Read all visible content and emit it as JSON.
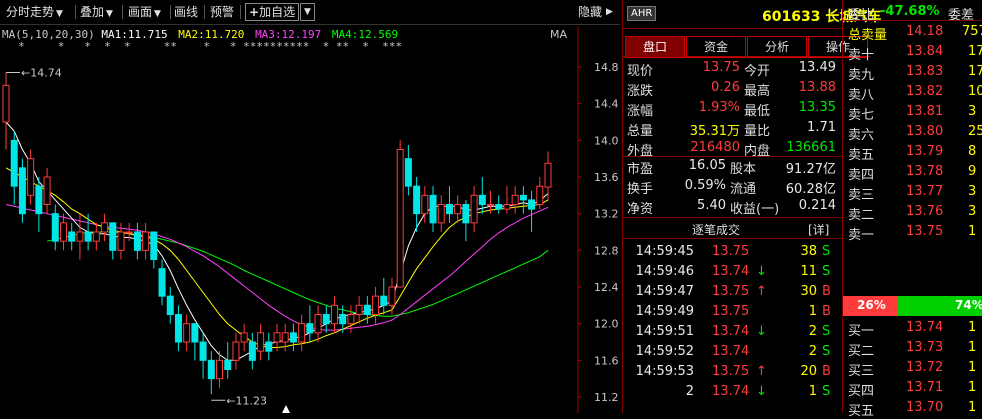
{
  "toolbar": {
    "items": [
      "分时走势",
      "叠加",
      "画面",
      "画线",
      "预警",
      "加自选"
    ],
    "hide_label": "隐藏"
  },
  "ma_legend": {
    "label": "MA(5,10,20,30)",
    "ma1": "MA1:11.715",
    "ma2": "MA2:11.720",
    "ma3": "MA3:12.197",
    "ma4": "MA4:12.569",
    "right_tag": "MA",
    "colors": {
      "ma1": "#ffffff",
      "ma2": "#ffff00",
      "ma3": "#ff40ff",
      "ma4": "#00ff00"
    }
  },
  "chart_data": {
    "type": "candlestick",
    "ylim": [
      11.2,
      14.8
    ],
    "y_ticks": [
      "14.8",
      "14.4",
      "14.0",
      "13.6",
      "13.2",
      "12.8",
      "12.4",
      "12.0",
      "11.6",
      "11.2"
    ],
    "high_label": "14.74",
    "low_label": "11.23",
    "star_markers": "*     *   *  *  *     **    *   * **********  * **  *  ***",
    "candles": [
      [
        14.2,
        14.6,
        14.74,
        13.9
      ],
      [
        14.0,
        13.5,
        14.1,
        13.3
      ],
      [
        13.7,
        13.2,
        13.8,
        13.1
      ],
      [
        13.4,
        13.8,
        13.9,
        13.3
      ],
      [
        13.5,
        13.2,
        13.6,
        13.0
      ],
      [
        13.3,
        13.6,
        13.7,
        13.2
      ],
      [
        13.2,
        12.9,
        13.3,
        12.8
      ],
      [
        12.9,
        13.1,
        13.2,
        12.8
      ],
      [
        13.0,
        12.9,
        13.1,
        12.8
      ],
      [
        12.9,
        13.0,
        13.2,
        12.7
      ],
      [
        13.0,
        12.9,
        13.2,
        12.8
      ],
      [
        12.9,
        13.0,
        13.1,
        12.8
      ],
      [
        13.0,
        13.1,
        13.2,
        12.9
      ],
      [
        13.1,
        12.8,
        13.1,
        12.7
      ],
      [
        12.8,
        13.0,
        13.1,
        12.7
      ],
      [
        13.0,
        13.0,
        13.1,
        12.9
      ],
      [
        13.0,
        12.8,
        13.1,
        12.7
      ],
      [
        12.8,
        13.0,
        13.1,
        12.7
      ],
      [
        13.0,
        12.7,
        13.0,
        12.6
      ],
      [
        12.6,
        12.3,
        12.7,
        12.2
      ],
      [
        12.3,
        12.1,
        12.4,
        12.0
      ],
      [
        12.1,
        11.8,
        12.2,
        11.7
      ],
      [
        11.8,
        12.0,
        12.1,
        11.7
      ],
      [
        12.0,
        11.8,
        12.0,
        11.6
      ],
      [
        11.8,
        11.6,
        11.9,
        11.4
      ],
      [
        11.6,
        11.4,
        11.7,
        11.23
      ],
      [
        11.4,
        11.6,
        11.7,
        11.3
      ],
      [
        11.6,
        11.5,
        11.8,
        11.4
      ],
      [
        11.6,
        11.8,
        11.9,
        11.5
      ],
      [
        11.8,
        11.9,
        12.0,
        11.7
      ],
      [
        11.8,
        11.6,
        11.9,
        11.5
      ],
      [
        11.7,
        11.9,
        12.0,
        11.6
      ],
      [
        11.8,
        11.7,
        11.9,
        11.6
      ],
      [
        11.8,
        11.9,
        12.0,
        11.7
      ],
      [
        11.8,
        11.9,
        12.0,
        11.7
      ],
      [
        11.9,
        11.8,
        12.0,
        11.7
      ],
      [
        11.8,
        12.0,
        12.1,
        11.7
      ],
      [
        12.0,
        11.9,
        12.2,
        11.8
      ],
      [
        11.9,
        12.1,
        12.2,
        11.8
      ],
      [
        12.1,
        12.0,
        12.2,
        11.9
      ],
      [
        12.0,
        12.2,
        12.3,
        11.9
      ],
      [
        12.1,
        12.0,
        12.2,
        11.9
      ],
      [
        12.0,
        12.1,
        12.2,
        11.9
      ],
      [
        12.1,
        12.2,
        12.3,
        12.0
      ],
      [
        12.2,
        12.1,
        12.3,
        12.0
      ],
      [
        12.1,
        12.3,
        12.4,
        12.0
      ],
      [
        12.3,
        12.2,
        12.5,
        12.1
      ],
      [
        12.2,
        12.4,
        12.5,
        12.1
      ],
      [
        12.4,
        13.9,
        14.0,
        12.4
      ],
      [
        13.8,
        13.5,
        13.95,
        13.4
      ],
      [
        13.5,
        13.2,
        13.6,
        13.0
      ],
      [
        13.2,
        13.4,
        13.5,
        13.1
      ],
      [
        13.4,
        13.1,
        13.5,
        13.0
      ],
      [
        13.1,
        13.3,
        13.4,
        13.0
      ],
      [
        13.3,
        13.2,
        13.5,
        13.1
      ],
      [
        13.2,
        13.3,
        13.4,
        13.1
      ],
      [
        13.3,
        13.1,
        13.35,
        12.9
      ],
      [
        13.1,
        13.4,
        13.5,
        13.0
      ],
      [
        13.4,
        13.3,
        13.6,
        13.2
      ],
      [
        13.3,
        13.3,
        13.45,
        13.2
      ],
      [
        13.3,
        13.25,
        13.4,
        13.2
      ],
      [
        13.25,
        13.3,
        13.5,
        13.2
      ],
      [
        13.3,
        13.4,
        13.5,
        13.2
      ],
      [
        13.4,
        13.35,
        13.5,
        13.2
      ],
      [
        13.35,
        13.25,
        13.45,
        13.0
      ],
      [
        13.3,
        13.5,
        13.6,
        13.25
      ],
      [
        13.49,
        13.75,
        13.88,
        13.35
      ]
    ],
    "ma1": [
      14.2,
      14.1,
      13.9,
      13.75,
      13.55,
      13.45,
      13.35,
      13.25,
      13.15,
      13.05,
      13.0,
      12.98,
      12.98,
      12.96,
      12.94,
      12.94,
      12.92,
      12.9,
      12.86,
      12.74,
      12.58,
      12.38,
      12.2,
      12.04,
      11.9,
      11.76,
      11.66,
      11.6,
      11.6,
      11.65,
      11.7,
      11.76,
      11.78,
      11.8,
      11.82,
      11.84,
      11.86,
      11.9,
      11.95,
      12.0,
      12.05,
      12.08,
      12.1,
      12.12,
      12.14,
      12.16,
      12.2,
      12.25,
      12.55,
      12.85,
      13.05,
      13.2,
      13.28,
      13.28,
      13.28,
      13.28,
      13.24,
      13.24,
      13.26,
      13.28,
      13.28,
      13.28,
      13.3,
      13.32,
      13.3,
      13.34,
      13.42
    ],
    "ma2": [
      13.7,
      13.65,
      13.6,
      13.55,
      13.5,
      13.45,
      13.4,
      13.33,
      13.25,
      13.2,
      13.14,
      13.08,
      13.05,
      13.02,
      13.0,
      12.98,
      12.96,
      12.95,
      12.92,
      12.87,
      12.8,
      12.7,
      12.58,
      12.46,
      12.34,
      12.22,
      12.1,
      12.0,
      11.93,
      11.86,
      11.8,
      11.76,
      11.74,
      11.74,
      11.75,
      11.77,
      11.78,
      11.8,
      11.83,
      11.87,
      11.9,
      11.94,
      11.98,
      12.02,
      12.06,
      12.09,
      12.12,
      12.15,
      12.3,
      12.45,
      12.6,
      12.72,
      12.84,
      12.95,
      13.05,
      13.12,
      13.16,
      13.2,
      13.22,
      13.24,
      13.25,
      13.26,
      13.27,
      13.28,
      13.29,
      13.3,
      13.35
    ],
    "ma3": [
      13.3,
      13.28,
      13.26,
      13.24,
      13.22,
      13.2,
      13.18,
      13.16,
      13.14,
      13.12,
      13.1,
      13.08,
      13.06,
      13.05,
      13.04,
      13.03,
      13.02,
      13.0,
      12.98,
      12.95,
      12.92,
      12.88,
      12.84,
      12.79,
      12.74,
      12.68,
      12.62,
      12.55,
      12.48,
      12.41,
      12.34,
      12.27,
      12.2,
      12.14,
      12.08,
      12.03,
      11.99,
      11.96,
      11.94,
      11.93,
      11.93,
      11.94,
      11.95,
      11.96,
      11.97,
      11.99,
      12.01,
      12.04,
      12.1,
      12.17,
      12.24,
      12.31,
      12.38,
      12.45,
      12.52,
      12.6,
      12.68,
      12.76,
      12.84,
      12.92,
      12.99,
      13.05,
      13.1,
      13.15,
      13.19,
      13.23,
      13.27
    ],
    "ma4": [
      null,
      null,
      null,
      null,
      null,
      12.9,
      12.92,
      12.94,
      12.96,
      12.98,
      13.0,
      13.0,
      13.0,
      13.0,
      12.99,
      12.98,
      12.97,
      12.96,
      12.94,
      12.92,
      12.9,
      12.88,
      12.85,
      12.82,
      12.79,
      12.75,
      12.71,
      12.67,
      12.63,
      12.58,
      12.54,
      12.5,
      12.46,
      12.42,
      12.38,
      12.34,
      12.3,
      12.26,
      12.23,
      12.2,
      12.17,
      12.15,
      12.13,
      12.11,
      12.1,
      12.09,
      12.08,
      12.08,
      12.1,
      12.12,
      12.15,
      12.18,
      12.21,
      12.25,
      12.29,
      12.33,
      12.37,
      12.41,
      12.45,
      12.49,
      12.53,
      12.57,
      12.61,
      12.65,
      12.69,
      12.73,
      12.8
    ]
  },
  "stock": {
    "tag": "AHR",
    "title": "601633 长城汽车"
  },
  "tabs": [
    "盘口",
    "资金",
    "分析",
    "操作"
  ],
  "quote": [
    {
      "l1": "现价",
      "v1": "13.75",
      "c1": "red",
      "l2": "今开",
      "v2": "13.49",
      "c2": "white"
    },
    {
      "l1": "涨跌",
      "v1": "0.26",
      "c1": "red",
      "l2": "最高",
      "v2": "13.88",
      "c2": "red"
    },
    {
      "l1": "涨幅",
      "v1": "1.93%",
      "c1": "red",
      "l2": "最低",
      "v2": "13.35",
      "c2": "green"
    },
    {
      "l1": "总量",
      "v1": "35.31万",
      "c1": "yellow",
      "l2": "量比",
      "v2": "1.71",
      "c2": "white"
    },
    {
      "l1": "外盘",
      "v1": "216480",
      "c1": "red",
      "l2": "内盘",
      "v2": "136661",
      "c2": "green"
    }
  ],
  "stats": [
    {
      "l1": "市盈",
      "v1": "16.05",
      "l2": "股本",
      "v2": "91.27亿"
    },
    {
      "l1": "换手",
      "v1": "0.59%",
      "l2": "流通",
      "v2": "60.28亿"
    },
    {
      "l1": "净资",
      "v1": "5.40",
      "l2": "收益(一)",
      "v2": "0.214"
    }
  ],
  "trades_header": {
    "title": "逐笔成交",
    "detail": "[详]"
  },
  "trades": [
    {
      "time": "14:59:45",
      "price": "13.75",
      "arrow": "",
      "vol": "38",
      "side": "S",
      "vcolor": "yellow",
      "scolor": "green"
    },
    {
      "time": "14:59:46",
      "price": "13.74",
      "arrow": "↓",
      "vol": "11",
      "side": "S",
      "vcolor": "yellow",
      "scolor": "green"
    },
    {
      "time": "14:59:47",
      "price": "13.75",
      "arrow": "↑",
      "vol": "30",
      "side": "B",
      "vcolor": "yellow",
      "scolor": "red"
    },
    {
      "time": "14:59:49",
      "price": "13.75",
      "arrow": "",
      "vol": "1",
      "side": "B",
      "vcolor": "yellow",
      "scolor": "red"
    },
    {
      "time": "14:59:51",
      "price": "13.74",
      "arrow": "↓",
      "vol": "2",
      "side": "S",
      "vcolor": "yellow",
      "scolor": "green"
    },
    {
      "time": "14:59:52",
      "price": "13.74",
      "arrow": "",
      "vol": "2",
      "side": "S",
      "vcolor": "yellow",
      "scolor": "green"
    },
    {
      "time": "14:59:53",
      "price": "13.75",
      "arrow": "↑",
      "vol": "20",
      "side": "B",
      "vcolor": "yellow",
      "scolor": "red"
    },
    {
      "time": "2",
      "price": "13.74",
      "arrow": "↓",
      "vol": "1",
      "side": "S",
      "vcolor": "yellow",
      "scolor": "green"
    }
  ],
  "orderbook": {
    "weibi_label": "委比",
    "weibi_value": "-47.68%",
    "weicha_label": "委差",
    "total_sell_label": "总卖量",
    "total_sell_price": "14.18",
    "total_sell_vol": "757",
    "sells": [
      {
        "label": "卖十",
        "price": "13.84",
        "vol": "17"
      },
      {
        "label": "卖九",
        "price": "13.83",
        "vol": "17"
      },
      {
        "label": "卖八",
        "price": "13.82",
        "vol": "10"
      },
      {
        "label": "卖七",
        "price": "13.81",
        "vol": "3"
      },
      {
        "label": "卖六",
        "price": "13.80",
        "vol": "25"
      },
      {
        "label": "卖五",
        "price": "13.79",
        "vol": "8"
      },
      {
        "label": "卖四",
        "price": "13.78",
        "vol": "9"
      },
      {
        "label": "卖三",
        "price": "13.77",
        "vol": "3"
      },
      {
        "label": "卖二",
        "price": "13.76",
        "vol": "3"
      },
      {
        "label": "卖一",
        "price": "13.75",
        "vol": "1"
      }
    ],
    "ratio_left": "26%",
    "ratio_right": "74%",
    "buys": [
      {
        "label": "买一",
        "price": "13.74",
        "vol": "1"
      },
      {
        "label": "买二",
        "price": "13.73",
        "vol": "1"
      },
      {
        "label": "买三",
        "price": "13.72",
        "vol": "1"
      },
      {
        "label": "买四",
        "price": "13.71",
        "vol": "1"
      },
      {
        "label": "买五",
        "price": "13.70",
        "vol": "1"
      }
    ]
  }
}
